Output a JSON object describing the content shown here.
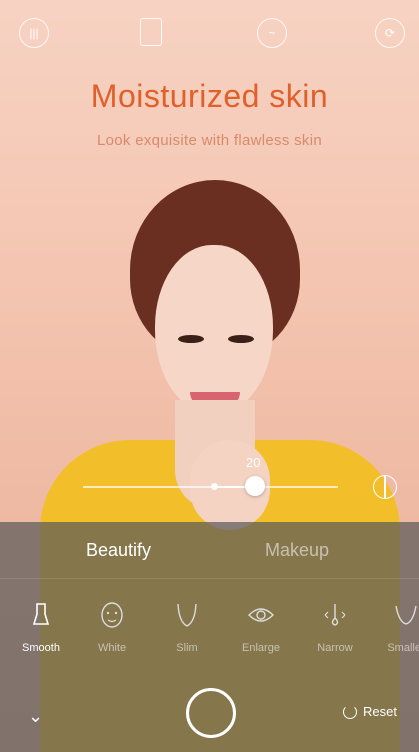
{
  "headline": "Moisturized skin",
  "subline": "Look exquisite with flawless skin",
  "slider": {
    "value": "20"
  },
  "tabs": [
    {
      "label": "Beautify",
      "active": true
    },
    {
      "label": "Makeup",
      "active": false
    }
  ],
  "tools": [
    {
      "label": "Smooth",
      "icon": "smooth-icon",
      "selected": true
    },
    {
      "label": "White",
      "icon": "white-face-icon",
      "selected": false
    },
    {
      "label": "Slim",
      "icon": "slim-face-icon",
      "selected": false
    },
    {
      "label": "Enlarge",
      "icon": "eye-icon",
      "selected": false
    },
    {
      "label": "Narrow",
      "icon": "nose-icon",
      "selected": false
    },
    {
      "label": "Smaller",
      "icon": "chin-icon",
      "selected": false
    }
  ],
  "bottom": {
    "reset_label": "Reset"
  },
  "colors": {
    "accent": "#e0602b",
    "subline": "#d98a6a",
    "panel": "#5a5a5a"
  }
}
